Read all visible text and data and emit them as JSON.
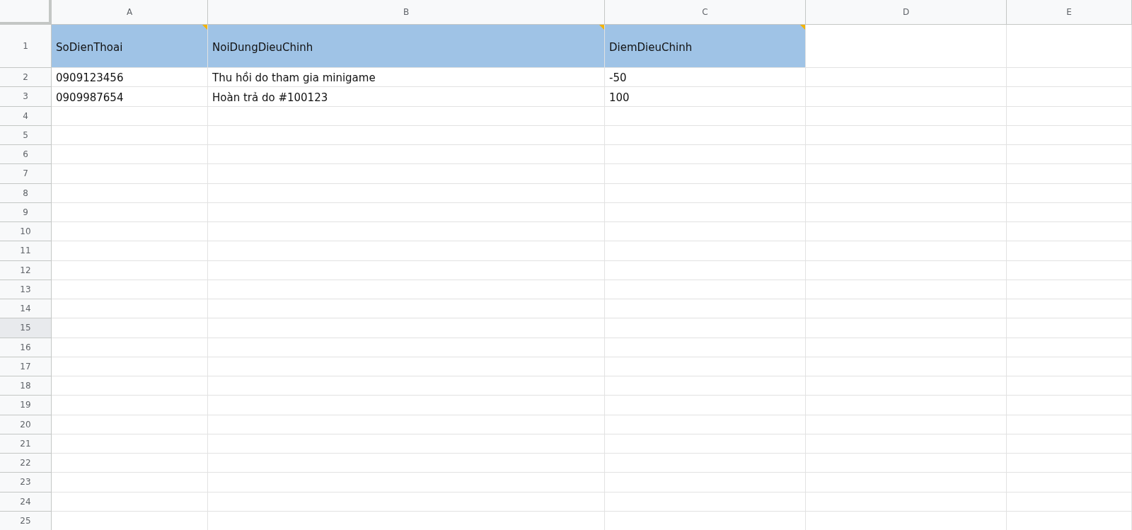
{
  "columns": [
    {
      "label": "A",
      "selected": false
    },
    {
      "label": "B",
      "selected": false
    },
    {
      "label": "C",
      "selected": false
    },
    {
      "label": "D",
      "selected": false
    },
    {
      "label": "E",
      "selected": false
    }
  ],
  "header_row": {
    "number": "1",
    "selected": false,
    "cells": [
      {
        "text": "SoDienThoai",
        "note": true
      },
      {
        "text": "NoiDungDieuChinh",
        "note": true
      },
      {
        "text": "DiemDieuChinh",
        "note": true
      }
    ]
  },
  "rows": [
    {
      "number": "2",
      "selected": false,
      "cells": [
        "0909123456",
        "Thu hồi do tham gia minigame",
        "-50"
      ]
    },
    {
      "number": "3",
      "selected": false,
      "cells": [
        "0909987654",
        "Hoàn trả do #100123",
        "100"
      ]
    },
    {
      "number": "4",
      "selected": false,
      "cells": []
    },
    {
      "number": "5",
      "selected": false,
      "cells": []
    },
    {
      "number": "6",
      "selected": false,
      "cells": []
    },
    {
      "number": "7",
      "selected": false,
      "cells": []
    },
    {
      "number": "8",
      "selected": false,
      "cells": []
    },
    {
      "number": "9",
      "selected": false,
      "cells": []
    },
    {
      "number": "10",
      "selected": false,
      "cells": []
    },
    {
      "number": "11",
      "selected": false,
      "cells": []
    },
    {
      "number": "12",
      "selected": false,
      "cells": []
    },
    {
      "number": "13",
      "selected": false,
      "cells": []
    },
    {
      "number": "14",
      "selected": false,
      "cells": []
    },
    {
      "number": "15",
      "selected": true,
      "cells": []
    },
    {
      "number": "16",
      "selected": false,
      "cells": []
    },
    {
      "number": "17",
      "selected": false,
      "cells": []
    },
    {
      "number": "18",
      "selected": false,
      "cells": []
    },
    {
      "number": "19",
      "selected": false,
      "cells": []
    },
    {
      "number": "20",
      "selected": false,
      "cells": []
    },
    {
      "number": "21",
      "selected": false,
      "cells": []
    },
    {
      "number": "22",
      "selected": false,
      "cells": []
    },
    {
      "number": "23",
      "selected": false,
      "cells": []
    },
    {
      "number": "24",
      "selected": false,
      "cells": []
    },
    {
      "number": "25",
      "selected": false,
      "cells": []
    }
  ]
}
